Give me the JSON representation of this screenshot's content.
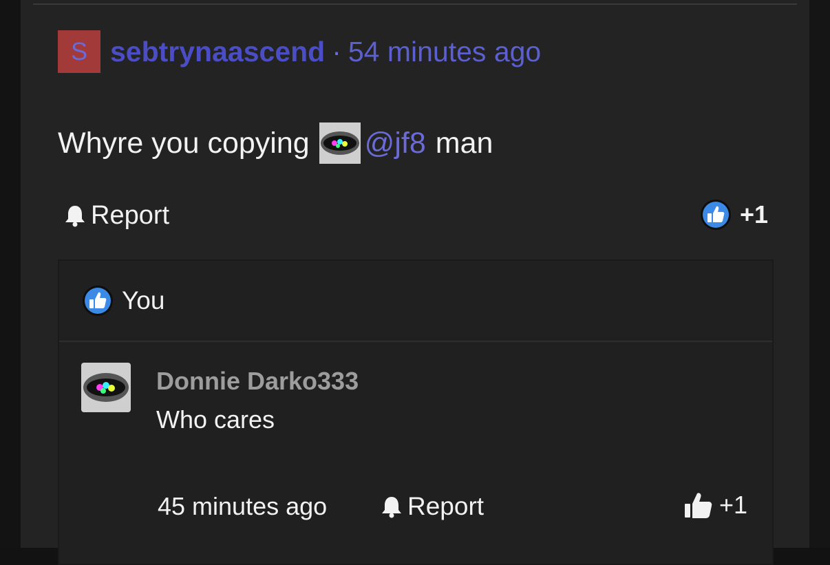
{
  "comment": {
    "avatar_letter": "S",
    "username": "sebtrynaascend",
    "separator": "·",
    "time": "54 minutes ago",
    "body_prefix": "Whyre you copying",
    "mention": "@jf8",
    "body_suffix": "man",
    "report_label": "Report",
    "like_count": "+1",
    "avatar_color": "#a23a3a"
  },
  "likers": {
    "name": "You"
  },
  "reply": {
    "author": "Donnie Darko333",
    "text": "Who cares",
    "time": "45 minutes ago",
    "report_label": "Report",
    "like_count": "+1"
  },
  "icons": {
    "bell": "bell-icon",
    "like": "like-circle-icon",
    "thumb": "thumbs-up-icon"
  },
  "colors": {
    "link": "#5b5fd0",
    "username": "#4a4dc4",
    "like_blue": "#3b8ae6"
  }
}
